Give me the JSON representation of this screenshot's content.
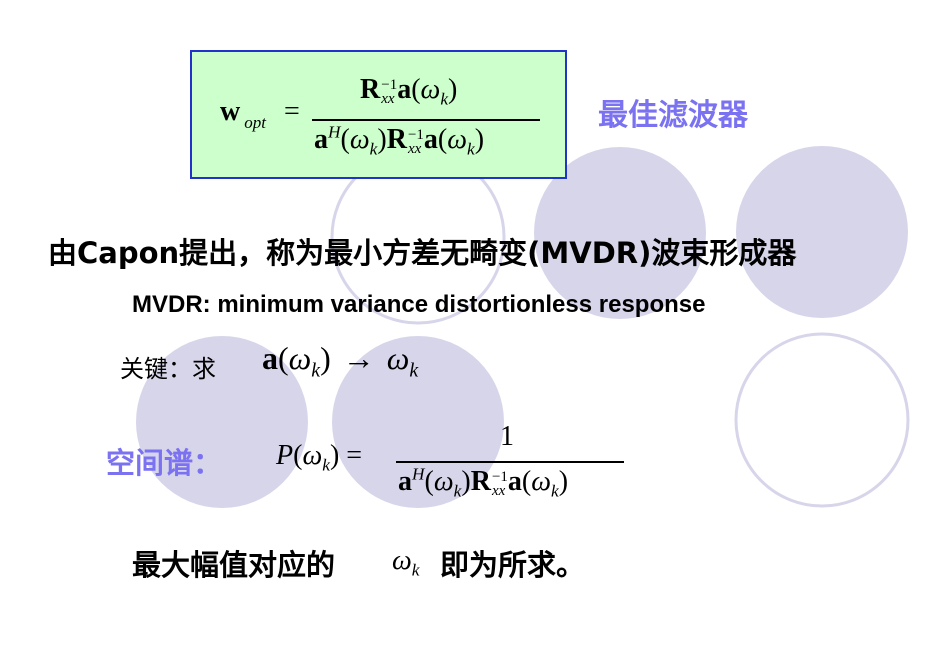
{
  "slide": {
    "title_label": "最佳滤波器",
    "intro_line": "由Capon提出，称为最小方差无畸变(MVDR)波束形成器",
    "mvdr_expansion": "MVDR: minimum variance distortionless response",
    "key_label": "关键：求",
    "spectrum_label": "空间谱：",
    "conclusion_prefix": "最大幅值对应的",
    "conclusion_suffix": "即为所求。"
  },
  "colors": {
    "formula_box_fill": "#ccffcc",
    "formula_box_border": "#2233cc",
    "accent_purple": "#7b72f2",
    "circle_fill": "#d7d5ea"
  }
}
